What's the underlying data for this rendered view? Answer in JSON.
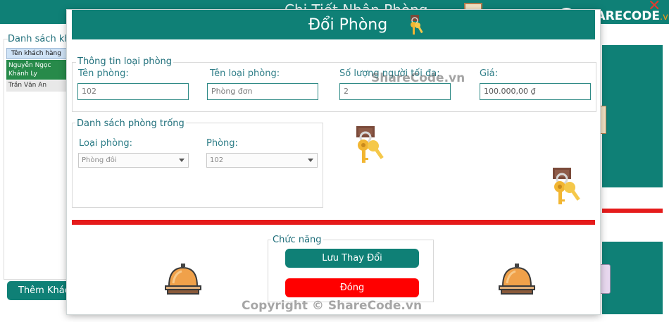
{
  "background_window": {
    "title": "Chi Tiết Nhận Phòng",
    "close_glyph": "✕",
    "customer_list": {
      "group_label": "Danh sách khách hàng",
      "column_header": "Tên khách hàng",
      "rows": [
        "Nguyễn Ngọc Khánh Ly",
        "Trần Văn An"
      ]
    },
    "add_button_label": "Thêm Khách hàng"
  },
  "logo": {
    "brand": "SHARECODE",
    "suffix": ".vn"
  },
  "dialog": {
    "title": "Đổi Phòng",
    "title_icon": "keys-icon",
    "room_type_info": {
      "group_label": "Thông tin loại phòng",
      "fields": [
        {
          "label": "Tên phòng:",
          "value": "102"
        },
        {
          "label": "Tên loại phòng:",
          "value": "Phòng đơn"
        },
        {
          "label": "Số lượng người tối đa:",
          "value": "2"
        },
        {
          "label": "Giá:",
          "value": "100.000,00 ₫"
        }
      ]
    },
    "empty_rooms": {
      "group_label": "Danh sách phòng trống",
      "room_type_label": "Loại phòng:",
      "room_type_selected": "Phòng đôi",
      "room_label": "Phòng:",
      "room_selected": "102"
    },
    "functions": {
      "group_label": "Chức năng",
      "save_label": "Lưu Thay Đổi",
      "close_label": "Đóng"
    }
  },
  "watermarks": {
    "center": "ShareCode.vn",
    "bottom": "Copyright © ShareCode.vn"
  },
  "colors": {
    "teal": "#0f8076",
    "red": "#e51b1b",
    "close_button": "#ff0000",
    "selected_row": "#278a4a"
  }
}
